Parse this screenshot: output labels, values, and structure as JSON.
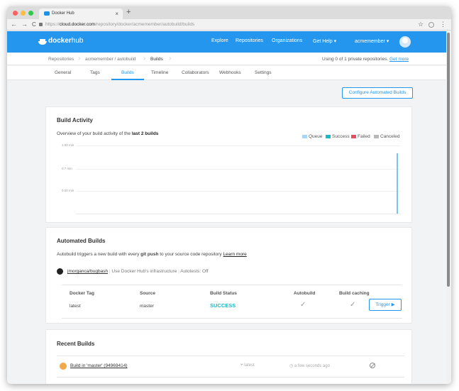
{
  "browser": {
    "tab_title": "Docker Hub",
    "tab_close": "×",
    "new_tab": "+",
    "url_scheme": "https://",
    "url_host": "cloud.docker.com",
    "url_path": "/repository/docker/acmemember/autobuild/builds",
    "back": "←",
    "forward": "→",
    "reload": "C",
    "star": "☆",
    "menu": "⋮"
  },
  "header": {
    "logo_docker": "docker",
    "logo_hub": "hub",
    "nav": [
      "Explore",
      "Repositories",
      "Organizations",
      "Get Help ▾"
    ],
    "user": "acmemember ▾"
  },
  "breadcrumb": {
    "items": [
      "Repositories",
      "acmemember / autobuild",
      "Builds"
    ],
    "usage_text": "Using 0 of 1 private repositories.",
    "usage_link": "Get more"
  },
  "tabs": [
    "General",
    "Tags",
    "Builds",
    "Timeline",
    "Collaborators",
    "Webhooks",
    "Settings"
  ],
  "active_tab": "Builds",
  "configure_button": "Configure Automated Builds",
  "build_activity": {
    "title": "Build Activity",
    "subtitle_prefix": "Overview of your build activity of the ",
    "subtitle_bold": "last 2 builds",
    "legend": [
      {
        "label": "Queue",
        "color": "#a9d6f5"
      },
      {
        "label": "Success",
        "color": "#19b9c9"
      },
      {
        "label": "Failed",
        "color": "#e3505f"
      },
      {
        "label": "Canceled",
        "color": "#b8b8b8"
      }
    ],
    "y_ticks": [
      "1.00 min",
      "0.7 min",
      "0.00 min"
    ]
  },
  "automated_builds": {
    "title": "Automated Builds",
    "desc_prefix": "Autobuild triggers a new build with every ",
    "desc_bold": "git push",
    "desc_suffix": " to your source code repository ",
    "desc_link": "Learn more",
    "repo": "jmorganca/bugbash",
    "infra": "Use Docker Hub's infrastructure",
    "autotests": "Autotests: Off",
    "columns": [
      "Docker Tag",
      "Source",
      "Build Status",
      "Autobuild",
      "Build caching"
    ],
    "row": {
      "tag": "latest",
      "source": "master",
      "status": "SUCCESS",
      "autobuild_check": "✓",
      "caching_check": "✓"
    },
    "trigger_button": "Trigger ▶"
  },
  "recent_builds": {
    "title": "Recent Builds",
    "items": [
      {
        "name": "Build in 'master' (94969414)",
        "tag": "latest",
        "time": "a few seconds ago"
      }
    ]
  }
}
